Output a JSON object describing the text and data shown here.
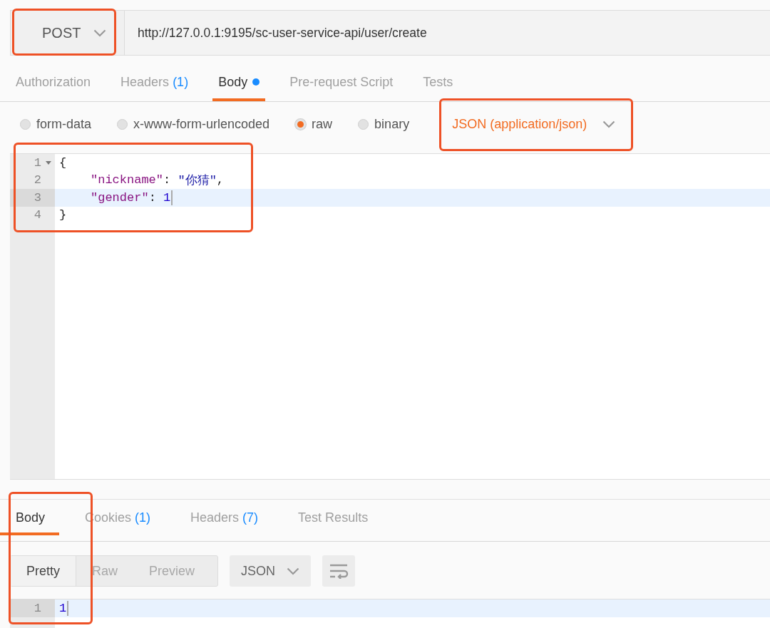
{
  "request": {
    "method": "POST",
    "url": "http://127.0.0.1:9195/sc-user-service-api/user/create",
    "outlined": true
  },
  "request_tabs": [
    {
      "label": "Authorization",
      "selected": false,
      "modified": false
    },
    {
      "label": "Headers",
      "count": "(1)",
      "selected": false,
      "modified": false
    },
    {
      "label": "Body",
      "selected": true,
      "modified": true
    },
    {
      "label": "Pre-request Script",
      "selected": false,
      "modified": false
    },
    {
      "label": "Tests",
      "selected": false,
      "modified": false
    }
  ],
  "body_types": [
    {
      "label": "form-data",
      "selected": false
    },
    {
      "label": "x-www-form-urlencoded",
      "selected": false
    },
    {
      "label": "raw",
      "selected": true
    },
    {
      "label": "binary",
      "selected": false
    }
  ],
  "body_format": {
    "label": "JSON (application/json)",
    "outlined": true
  },
  "request_body": {
    "outlined": true,
    "lines": [
      {
        "number": "1",
        "foldable": true,
        "indented": false,
        "highlighted": false,
        "cursor": false,
        "tokens": [
          {
            "kind": "punct",
            "text": "{"
          }
        ]
      },
      {
        "number": "2",
        "foldable": false,
        "indented": true,
        "highlighted": false,
        "cursor": false,
        "tokens": [
          {
            "kind": "key",
            "text": "\"nickname\""
          },
          {
            "kind": "punct",
            "text": ": "
          },
          {
            "kind": "string",
            "text": "\"你猜\""
          },
          {
            "kind": "punct",
            "text": ","
          }
        ]
      },
      {
        "number": "3",
        "foldable": false,
        "indented": true,
        "highlighted": true,
        "cursor": true,
        "tokens": [
          {
            "kind": "key",
            "text": "\"gender\""
          },
          {
            "kind": "punct",
            "text": ": "
          },
          {
            "kind": "number",
            "text": "1"
          }
        ]
      },
      {
        "number": "4",
        "foldable": false,
        "indented": false,
        "highlighted": false,
        "cursor": false,
        "tokens": [
          {
            "kind": "punct",
            "text": "}"
          }
        ]
      }
    ]
  },
  "response_tabs": [
    {
      "label": "Body",
      "selected": true
    },
    {
      "label": "Cookies",
      "count": "(1)",
      "selected": false
    },
    {
      "label": "Headers",
      "count": "(7)",
      "selected": false
    },
    {
      "label": "Test Results",
      "selected": false
    }
  ],
  "view_modes": [
    {
      "label": "Pretty",
      "selected": true
    },
    {
      "label": "Raw",
      "selected": false
    },
    {
      "label": "Preview",
      "selected": false
    }
  ],
  "response_format": "JSON",
  "response_body": {
    "outlined": true,
    "lines": [
      {
        "number": "1",
        "foldable": false,
        "indented": false,
        "highlighted": true,
        "cursor": true,
        "tokens": [
          {
            "kind": "number",
            "text": "1"
          }
        ]
      }
    ]
  }
}
